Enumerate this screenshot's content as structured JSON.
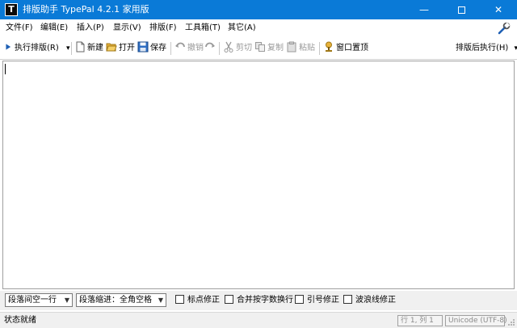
{
  "window": {
    "title": "排版助手 TypePal 4.2.1 家用版",
    "app_icon_letter": "T",
    "minimize_glyph": "—",
    "close_glyph": "✕"
  },
  "menu": {
    "items": [
      "文件(F)",
      "编辑(E)",
      "插入(P)",
      "显示(V)",
      "排版(F)",
      "工具箱(T)",
      "其它(A)"
    ]
  },
  "toolbar": {
    "run_label": "执行排版(R)",
    "run_dropdown_glyph": "▾",
    "new_label": "新建",
    "open_label": "打开",
    "save_label": "保存",
    "undo_label": "撤销",
    "cut_label": "剪切",
    "copy_label": "复制",
    "paste_label": "粘贴",
    "pin_label": "窗口置顶",
    "after_run_label": "排版后执行(H)",
    "after_run_dropdown_glyph": "▾"
  },
  "editor": {
    "content": ""
  },
  "options": {
    "paragraph_spacing": "段落间空一行",
    "paragraph_indent": "段落缩进：全角空格",
    "dropdown_glyph": "▼",
    "checkboxes": [
      "标点修正",
      "合并按字数换行",
      "引号修正",
      "波浪线修正"
    ]
  },
  "status": {
    "text": "状态就绪",
    "position": "行 1, 列 1",
    "encoding": "Unicode (UTF-8)"
  },
  "colors": {
    "titlebar": "#0a7ad7",
    "accent_blue": "#1e5fb4",
    "folder_yellow": "#e8b23a",
    "disabled_gray": "#9a9a9a"
  }
}
